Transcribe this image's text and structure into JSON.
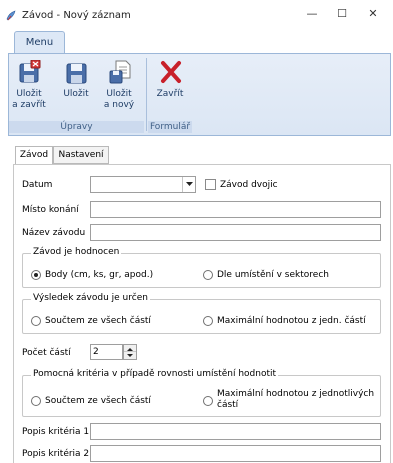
{
  "window": {
    "title": "Závod - Nový záznam",
    "minimize_glyph": "—",
    "maximize_glyph": "☐",
    "close_glyph": "✕"
  },
  "ribbon": {
    "tab": "Menu",
    "groups": [
      {
        "label": "Úpravy"
      },
      {
        "label": "Formulář"
      }
    ],
    "buttons": {
      "save_close": {
        "line1": "Uložit",
        "line2": "a zavřít",
        "icon": "save-close-icon"
      },
      "save": {
        "line1": "Uložit",
        "line2": "",
        "icon": "save-icon"
      },
      "save_new": {
        "line1": "Uložit",
        "line2": "a nový",
        "icon": "save-new-icon"
      },
      "close": {
        "line1": "Zavřít",
        "line2": "",
        "icon": "close-x-icon"
      }
    }
  },
  "tabs": {
    "zavod": "Závod",
    "nastaveni": "Nastavení"
  },
  "form": {
    "datum_label": "Datum",
    "datum_value": "",
    "double_race_label": "Závod dvojic",
    "double_race_checked": false,
    "venue_label": "Místo konání",
    "venue_value": "",
    "race_name_label": "Název závodu",
    "race_name_value": "",
    "evaluated": {
      "title": "Závod je hodnocen",
      "opt1": "Body (cm, ks, gr, apod.)",
      "opt2": "Dle umístění v sektorech",
      "selected": "opt1"
    },
    "result": {
      "title": "Výsledek závodu je určen",
      "opt1": "Součtem ze všech částí",
      "opt2": "Maximální hodnotou z jedn. částí"
    },
    "parts_label": "Počet částí",
    "parts_value": "2",
    "aux": {
      "title": "Pomocná kritéria v případě rovnosti umístění hodnotit",
      "opt1": "Součtem ze všech částí",
      "opt2_line1": "Maximální hodnotou z jednotlivých",
      "opt2_line2": "částí"
    },
    "crit1_label": "Popis kritéria 1",
    "crit1_value": "",
    "crit2_label": "Popis kritéria 2",
    "crit2_value": ""
  },
  "colors": {
    "ribbon_bg": "#dbe6f4",
    "close_x": "#c8202a",
    "floppy": "#4a6ea8"
  }
}
